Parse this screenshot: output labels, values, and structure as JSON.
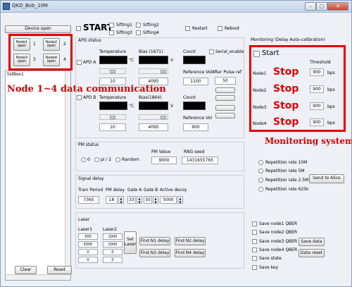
{
  "window": {
    "title": "QKD_Bob_10M",
    "min": "–",
    "max": "□",
    "close": "✕"
  },
  "left": {
    "device_open": "Device open",
    "nodes": [
      {
        "label": "Node1 open",
        "num": "1"
      },
      {
        "label": "Node2 open",
        "num": "2"
      },
      {
        "label": "Node3 open",
        "num": "3"
      },
      {
        "label": "Node4 open",
        "num": "4"
      }
    ],
    "listbox": "listBox1",
    "clear": "Clear",
    "reset": "Reset"
  },
  "top": {
    "start": "START",
    "sifting": [
      "Sifting1",
      "Sifting2",
      "Sifting3",
      "Sifting4"
    ],
    "restart": "Restart",
    "reboot": "Reboot"
  },
  "apd": {
    "title": "APD status",
    "serial_enable": "Serial_enable",
    "after_pulse": "After Pulse ref",
    "after_pulse_value": "50",
    "a": {
      "name": "APD A",
      "temp_label": "Temperature",
      "temp_unit": "°C",
      "bias_label": "Bias (1671)",
      "bias_unit": "V",
      "count_label": "Count",
      "ref_label": "Reference Vol",
      "temp_val": "10",
      "bias_val": "4095",
      "ref_val": "1100"
    },
    "b": {
      "name": "APD B",
      "temp_label": "Temperature",
      "temp_unit": "°C",
      "bias_label": "Bias(1864)",
      "bias_unit": "V",
      "count_label": "Count",
      "ref_label": "Reference Vol",
      "temp_val": "10",
      "bias_val": "4095",
      "ref_val": "900"
    }
  },
  "pm": {
    "title": "PM status",
    "options": [
      "0",
      "pi / 2",
      "Random"
    ],
    "pm_value_label": "PM Value",
    "pm_value": "9000",
    "rng_label": "RNG seed",
    "rng_value": "1431655765"
  },
  "signal": {
    "title": "Signal delay",
    "labels": [
      "Train Period",
      "PM delay",
      "Gate A",
      "Gate B",
      "Active decoy"
    ],
    "values": [
      "7365",
      "18",
      "33",
      "35",
      "5000"
    ]
  },
  "laser": {
    "title": "Laser",
    "laser1": "Laser1",
    "laser2": "Laser2",
    "l1": [
      "500",
      "5000",
      "0",
      "0"
    ],
    "l2": [
      "1000",
      "2000",
      "0",
      "0"
    ],
    "set_laser": "Set Laser",
    "find": [
      "Find N1 delay",
      "Find N2 delay",
      "Find N3 delay",
      "Find N4 delay"
    ]
  },
  "monitor": {
    "title": "Monitoring (Delay Auto-calibration)",
    "start": "Start",
    "threshold": "Threshold",
    "nodes": [
      {
        "name": "Node1",
        "status": "Stop",
        "value": "900",
        "unit": "bps"
      },
      {
        "name": "Node2",
        "status": "Stop",
        "value": "900",
        "unit": "bps"
      },
      {
        "name": "Node3",
        "status": "Stop",
        "value": "900",
        "unit": "bps"
      },
      {
        "name": "Node4",
        "status": "Stop",
        "value": "900",
        "unit": "bps"
      }
    ]
  },
  "rates": {
    "options": [
      "Repetition rate 10M",
      "Repetition rate 5M",
      "Repetition rate 2.5M",
      "Repetition rate 625k"
    ],
    "send": "Send to Alice"
  },
  "save": {
    "options": [
      "Save node1 QBER",
      "Save node2 QBER",
      "Save node3 QBER",
      "Save node4 QBER",
      "Save state",
      "Save key"
    ],
    "save_data": "Save data",
    "data_reset": "Data reset"
  },
  "annotations": {
    "node_comm": "Node 1~4 data communication",
    "monitoring": "Monitoring system"
  }
}
